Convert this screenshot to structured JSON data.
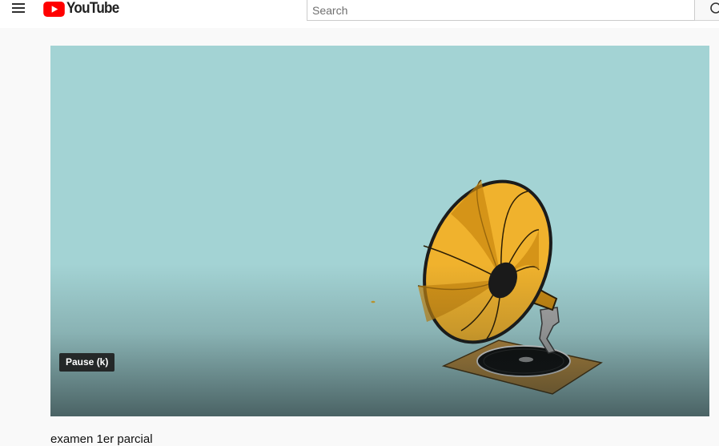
{
  "header": {
    "logo_text": "YouTube",
    "logo_color": "#ff0000",
    "menu_icon": "hamburger-menu-icon",
    "search": {
      "placeholder": "Search",
      "value": "",
      "button_icon": "search-icon"
    }
  },
  "player": {
    "background_color": "#a3d3d4",
    "tooltip": "Pause (k)",
    "content": "gramophone-illustration"
  },
  "video": {
    "title": "examen 1er parcial"
  }
}
